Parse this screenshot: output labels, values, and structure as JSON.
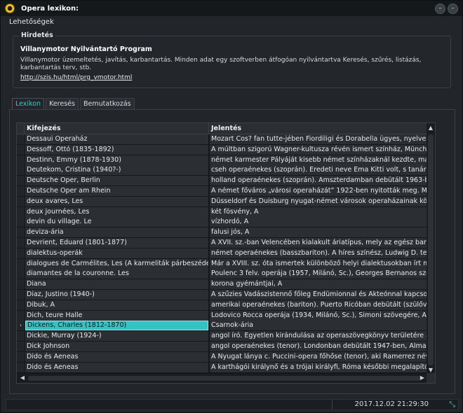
{
  "window": {
    "title": "Opera lexikon:",
    "minimize": "–",
    "close": "–"
  },
  "menu": {
    "options": "Lehetőségek"
  },
  "ad": {
    "legend": "Hirdetés",
    "title": "Villanymotor Nyilvántartó Program",
    "text": "Villanymotor üzemeltetés, javítás, karbantartás. Minden adat egy szoftverben átfogóan nyilvántartva Keresés, szűrés, listázás, karbantartás terv, stb.",
    "link": "http://szis.hu/html/prg_vmotor.html"
  },
  "tabs": [
    {
      "label": "Lexikon",
      "active": true
    },
    {
      "label": "Keresés",
      "active": false
    },
    {
      "label": "Bemutatkozás",
      "active": false
    }
  ],
  "grid": {
    "columns": [
      "Kifejezés",
      "Jelentés"
    ],
    "rows": [
      [
        "Dessaui Operaház",
        "Mozart Cos? fan tutte-jében Fiordiligi és Dorabella ügyes, nyelves és"
      ],
      [
        "Dessoff, Ottó (1835-1892)",
        "A múltban szigorú Wagner-kultusza révén ismert színház, München u"
      ],
      [
        "Destinn, Emmy (1878-1930)",
        "német karmester Pályáját kisebb német színházaknál kezdte, majd 18"
      ],
      [
        "Deutekom, Cristina (1940?-)",
        "cseh operaénekes (szoprán). Eredeti neve Ema Kitti volt, s tanárána"
      ],
      [
        "Deutsche Oper, Berlin",
        "holland operaénekes (szoprán). Amszterdamban debütált 1963-ban,"
      ],
      [
        "Deutsche Oper am Rhein",
        "A német főváros „városi operaházát” 1922-ben nyitották meg. Művé"
      ],
      [
        "deux avares, Les",
        "Düsseldorf és Duisburg nyugat-német városok operaházainak közös"
      ],
      [
        "deux journées, Les",
        "két fösvény, A"
      ],
      [
        "devin du village. Le",
        "vízhordó, A"
      ],
      [
        "deviza-ária",
        "falusi jós, A"
      ],
      [
        "Devrient, Eduard (1801-1877)",
        "A XVII. sz.-ban Velencében kialakult áriatípus, mely az egész barokk"
      ],
      [
        "dialektus-operák",
        "német operaénekes (basszbariton). A híres színész, Ludwig D. testve"
      ],
      [
        "dialogues de Carmélites, Les (A karmeliták párbeszédei)",
        "Már a XVIII. sz. óta ismertek különböző helyi dialektusokban írt műve"
      ],
      [
        "diamantes de la couronne. Les",
        "Poulenc 3 felv. operája (1957, Milánó, Sc.), Georges Bernanos szöve"
      ],
      [
        "Diana",
        "korona gyémántjai, A"
      ],
      [
        "Diaz, Justino (1940-)",
        "A szűzies Vadászistennő főleg Endümionnal és Akteónnal kapcsolatba"
      ],
      [
        "Dibuk, A",
        "amerikai operaénekes (bariton). Puerto Ricóban debütált (szülőváros"
      ],
      [
        "Dich, teure Halle",
        "Lodovico Rocca operája (1934, Milánó, Sc.), Simoni szövegére, An-S"
      ],
      [
        "Dickens, Charles (1812-1870)",
        "Csarnok-ária"
      ],
      [
        "Dickie, Murray (1924-)",
        "angol író. Egyetlen kirándulása az operaszövegkönyv területére a Th"
      ],
      [
        "Dick Johnson",
        "angol operaénekes (tenor). Londonban debütált 1947-ben, Almaviva"
      ],
      [
        "Dido és Aeneas",
        "A Nyugat lánya c. Puccini-opera főhőse (tenor), aki Ramerrez néven"
      ],
      [
        "Dido és Aeneas",
        "A karthágói királynő és a trójai királyfi, Róma későbbi megalapítója, r"
      ]
    ],
    "selected_index": 18,
    "selected_marker": "›"
  },
  "status": {
    "datetime": "2017.12.02 21:29:30",
    "resize_glyph": "⤡"
  },
  "colors": {
    "accent": "#35c2c2",
    "background": "#22262a",
    "titlebar": "#15181b"
  }
}
